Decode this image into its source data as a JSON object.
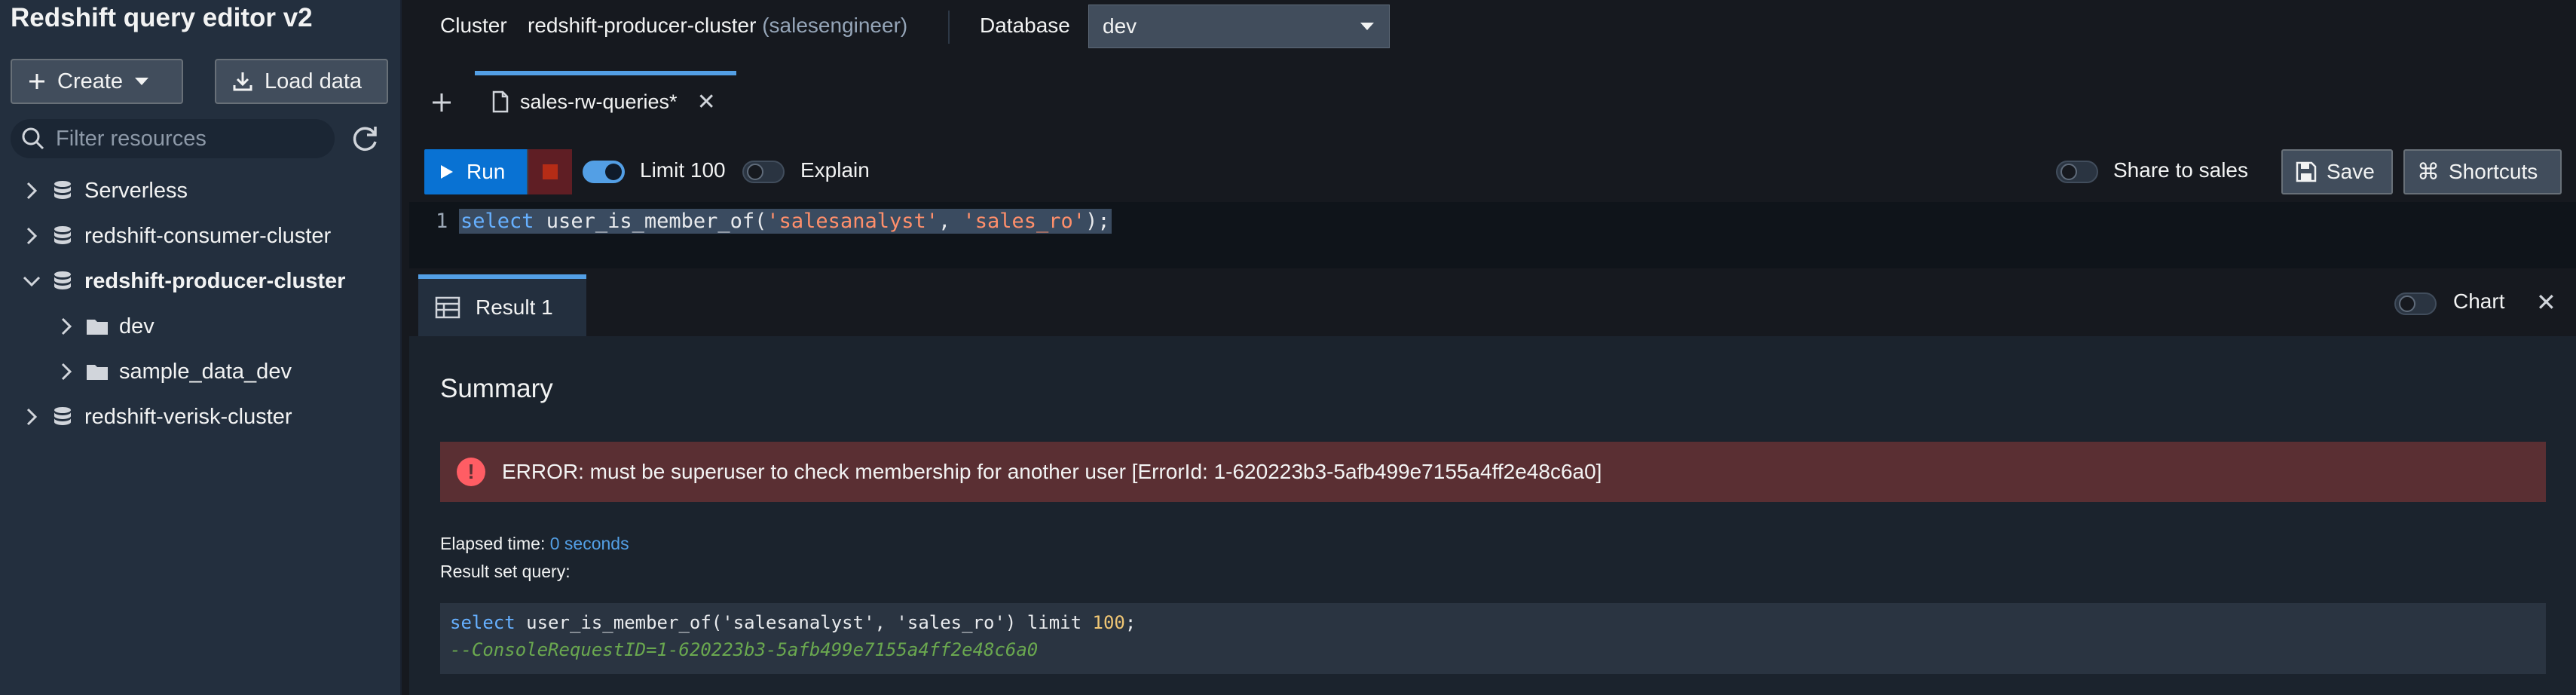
{
  "app": {
    "title": "Redshift query editor v2"
  },
  "sidebar": {
    "create_label": "Create",
    "load_label": "Load data",
    "filter_placeholder": "Filter resources",
    "tree": [
      {
        "label": "Serverless"
      },
      {
        "label": "redshift-consumer-cluster"
      },
      {
        "label": "redshift-producer-cluster"
      },
      {
        "label": "dev"
      },
      {
        "label": "sample_data_dev"
      },
      {
        "label": "redshift-verisk-cluster"
      }
    ]
  },
  "topbar": {
    "cluster_label": "Cluster",
    "cluster_name": "redshift-producer-cluster",
    "cluster_user": "(salesengineer)",
    "database_label": "Database",
    "database_value": "dev"
  },
  "tabs": [
    {
      "label": "sales-rw-queries*"
    }
  ],
  "toolbar": {
    "run_label": "Run",
    "limit_label": "Limit 100",
    "explain_label": "Explain",
    "share_label": "Share to sales",
    "save_label": "Save",
    "shortcuts_label": "Shortcuts"
  },
  "editor": {
    "line_number": "1",
    "keyword": "select",
    "function": " user_is_member_of(",
    "arg1": "'salesanalyst'",
    "sep": ", ",
    "arg2": "'sales_ro'",
    "end": ");"
  },
  "results": {
    "tab_label": "Result 1",
    "chart_label": "Chart",
    "summary_title": "Summary",
    "error_text": "ERROR: must be superuser to check membership for another user [ErrorId: 1-620223b3-5afb499e7155a4ff2e48c6a0]",
    "elapsed_label": "Elapsed time:",
    "elapsed_value": "0 seconds",
    "result_set_label": "Result set query:",
    "sql_keyword": "select",
    "sql_rest": " user_is_member_of('salesanalyst', 'sales_ro') limit ",
    "sql_limit": "100",
    "sql_end": ";",
    "sql_comment": "--ConsoleRequestID=1-620223b3-5afb499e7155a4ff2e48c6a0"
  },
  "colors": {
    "accent": "#539fe5",
    "run_button": "#0972d3",
    "error_background": "#5a2f33",
    "error_icon": "#ff5d64"
  }
}
